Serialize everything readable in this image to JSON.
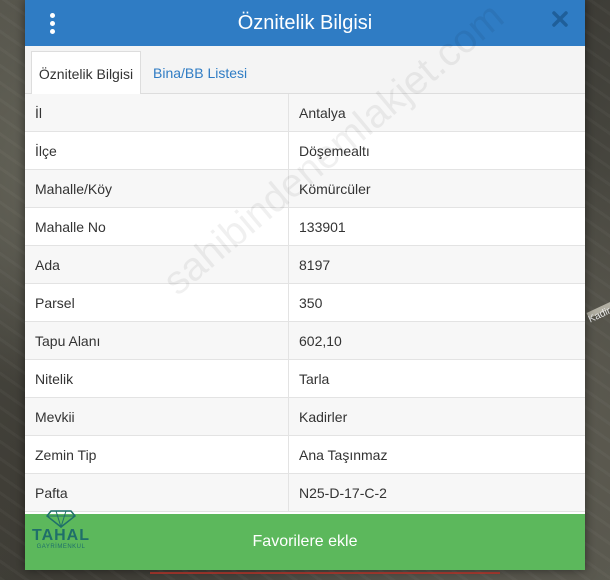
{
  "map": {
    "road_label": "Kadir"
  },
  "dialog": {
    "title": "Öznitelik Bilgisi",
    "menu_icon": "vertical-dots-icon",
    "close_icon": "close-icon"
  },
  "tabs": [
    {
      "label": "Öznitelik Bilgisi",
      "active": true
    },
    {
      "label": "Bina/BB Listesi",
      "active": false
    }
  ],
  "attributes": [
    {
      "label": "İl",
      "value": "Antalya"
    },
    {
      "label": "İlçe",
      "value": "Döşemealtı"
    },
    {
      "label": "Mahalle/Köy",
      "value": "Kömürcüler"
    },
    {
      "label": "Mahalle No",
      "value": "133901"
    },
    {
      "label": "Ada",
      "value": "8197"
    },
    {
      "label": "Parsel",
      "value": "350"
    },
    {
      "label": "Tapu Alanı",
      "value": "602,10"
    },
    {
      "label": "Nitelik",
      "value": "Tarla"
    },
    {
      "label": "Mevkii",
      "value": "Kadirler"
    },
    {
      "label": "Zemin Tip",
      "value": "Ana Taşınmaz"
    },
    {
      "label": "Pafta",
      "value": "N25-D-17-C-2"
    }
  ],
  "watermark": "sahibindenemlakjet.com",
  "footer": {
    "favorite_label": "Favorilere ekle",
    "logo_name": "TAHAL",
    "logo_sub": "GAYRİMENKUL"
  },
  "colors": {
    "header": "#2f7cc4",
    "button": "#5cb85c",
    "tab_link": "#2f7cc4"
  }
}
